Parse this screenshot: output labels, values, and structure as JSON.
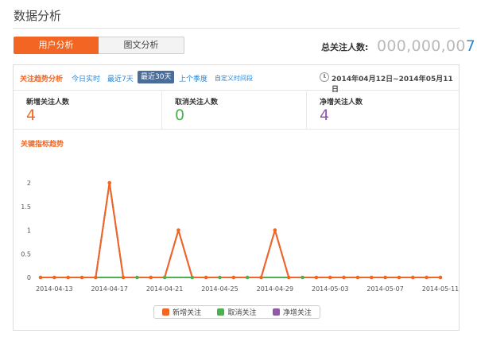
{
  "page": {
    "title": "数据分析"
  },
  "tabs": [
    {
      "label": "用户分析",
      "active": true
    },
    {
      "label": "图文分析",
      "active": false
    }
  ],
  "total": {
    "label": "总关注人数:",
    "value_prefix": "000,000,00",
    "value_last": "7"
  },
  "toolbar": {
    "title": "关注趋势分析",
    "links": [
      "今日实时",
      "最近7天"
    ],
    "active": "最近30天",
    "season": "上个季度",
    "custom": "自定义时间段",
    "date_range": "2014年04月12日~2014年05月11日"
  },
  "stats": [
    {
      "label": "新增关注人数",
      "value": "4"
    },
    {
      "label": "取消关注人数",
      "value": "0"
    },
    {
      "label": "净增关注人数",
      "value": "4"
    }
  ],
  "colors": {
    "new": "#f26522",
    "cancel": "#4caf50",
    "net": "#8e5aa8",
    "accent": "#2a86d3"
  },
  "chart_title": "关键指标趋势",
  "chart_data": {
    "type": "line",
    "x": [
      "2014-04-12",
      "2014-04-13",
      "2014-04-14",
      "2014-04-15",
      "2014-04-16",
      "2014-04-17",
      "2014-04-18",
      "2014-04-19",
      "2014-04-20",
      "2014-04-21",
      "2014-04-22",
      "2014-04-23",
      "2014-04-24",
      "2014-04-25",
      "2014-04-26",
      "2014-04-27",
      "2014-04-28",
      "2014-04-29",
      "2014-04-30",
      "2014-05-01",
      "2014-05-02",
      "2014-05-03",
      "2014-05-04",
      "2014-05-05",
      "2014-05-06",
      "2014-05-07",
      "2014-05-08",
      "2014-05-09",
      "2014-05-10",
      "2014-05-11"
    ],
    "x_tick_labels": [
      "2014-04-13",
      "2014-04-17",
      "2014-04-21",
      "2014-04-25",
      "2014-04-29",
      "2014-05-03",
      "2014-05-07",
      "2014-05-11"
    ],
    "y_ticks": [
      "0",
      "0.5",
      "1",
      "1.5",
      "2"
    ],
    "ylim": [
      0,
      2
    ],
    "series": [
      {
        "name": "新增关注",
        "color": "#f26522",
        "values": [
          0,
          0,
          0,
          0,
          0,
          2,
          0,
          0,
          0,
          0,
          1,
          0,
          0,
          0,
          0,
          0,
          0,
          1,
          0,
          0,
          0,
          0,
          0,
          0,
          0,
          0,
          0,
          0,
          0,
          0
        ]
      },
      {
        "name": "取消关注",
        "color": "#4caf50",
        "values": [
          0,
          0,
          0,
          0,
          0,
          0,
          0,
          0,
          0,
          0,
          0,
          0,
          0,
          0,
          0,
          0,
          0,
          0,
          0,
          0,
          0,
          0,
          0,
          0,
          0,
          0,
          0,
          0,
          0,
          0
        ]
      },
      {
        "name": "净增关注",
        "color": "#8e5aa8",
        "values": [
          0,
          0,
          0,
          0,
          0,
          2,
          0,
          0,
          0,
          0,
          1,
          0,
          0,
          0,
          0,
          0,
          0,
          1,
          0,
          0,
          0,
          0,
          0,
          0,
          0,
          0,
          0,
          0,
          0,
          0
        ]
      }
    ],
    "legend": [
      "新增关注",
      "取消关注",
      "净增关注"
    ],
    "legend_position": "bottom",
    "grid": false
  }
}
